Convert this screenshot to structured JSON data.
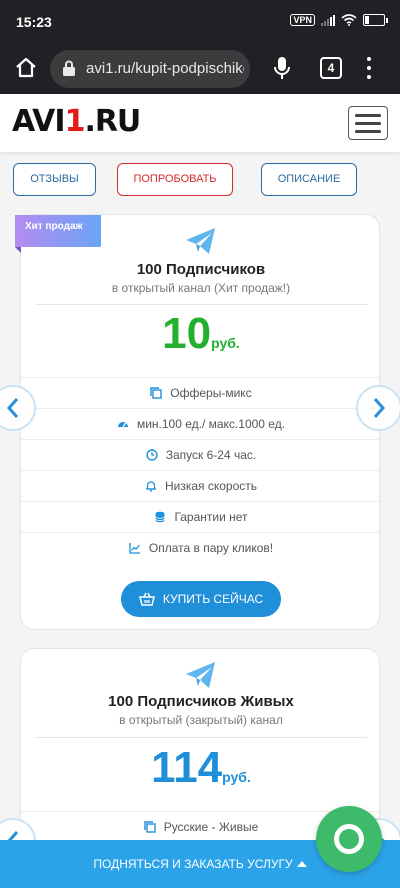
{
  "statusbar": {
    "time": "15:23",
    "vpn": "VPN",
    "battery": "23",
    "battery_level": 0.23
  },
  "browser": {
    "url": "avi1.ru/kupit-podpischiko",
    "tab_count": "4"
  },
  "header": {
    "logo_left": "AVI",
    "logo_mid": "1",
    "logo_right": ".RU"
  },
  "nav": {
    "reviews": "ОТЗЫВЫ",
    "try": "ПОПРОБОВАТЬ",
    "description": "ОПИСАНИЕ"
  },
  "cards": [
    {
      "badge": "Хит продаж",
      "title": "100 Подписчиков",
      "subtitle": "в открытый канал (Хит продаж!)",
      "price": "10",
      "currency": "руб.",
      "price_color": "#23b02f",
      "features": [
        {
          "icon": "copy-icon",
          "text": "Офферы-микс"
        },
        {
          "icon": "speedometer-icon",
          "text": "мин.100 ед./ макс.1000 ед."
        },
        {
          "icon": "clock-icon",
          "text": "Запуск 6-24 час."
        },
        {
          "icon": "bell-icon",
          "text": "Низкая скорость"
        },
        {
          "icon": "database-icon",
          "text": "Гарантии нет"
        },
        {
          "icon": "chart-line-icon",
          "text": "Оплата в пару кликов!"
        }
      ],
      "buy_label": "КУПИТЬ СЕЙЧАС"
    },
    {
      "title": "100 Подписчиков Живых",
      "subtitle": "в открытый (закрытый) канал",
      "price": "114",
      "currency": "руб.",
      "price_color": "#1e8fd8",
      "features": [
        {
          "icon": "copy-icon",
          "text": "Русские - Живые"
        }
      ]
    }
  ],
  "bottom_bar": {
    "label": "ПОДНЯТЬСЯ И ЗАКАЗАТЬ УСЛУГУ"
  },
  "colors": {
    "accent": "#1e8fd8",
    "brand_red": "#e41b17",
    "chat": "#3dbb6a"
  }
}
